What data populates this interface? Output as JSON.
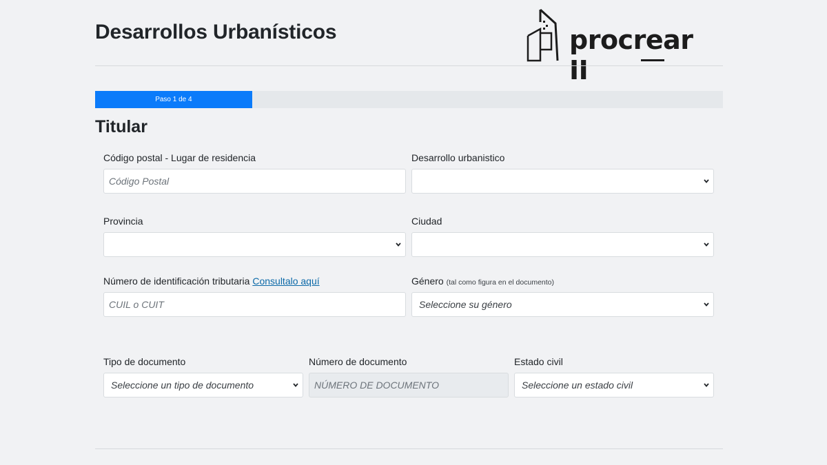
{
  "header": {
    "title": "Desarrollos Urbanísticos",
    "logo_text": "procrear II"
  },
  "progress": {
    "label": "Paso 1 de 4",
    "current_step": 1,
    "total_steps": 4,
    "fraction": 0.25,
    "fill_color": "#0b7bfa"
  },
  "section": {
    "title": "Titular"
  },
  "form": {
    "codigo_postal": {
      "label": "Código postal - Lugar de residencia",
      "placeholder": "Código Postal",
      "value": ""
    },
    "desarrollo": {
      "label": "Desarrollo urbanistico",
      "selected": ""
    },
    "provincia": {
      "label": "Provincia",
      "selected": ""
    },
    "ciudad": {
      "label": "Ciudad",
      "selected": ""
    },
    "cuil": {
      "label": "Número de identificación tributaria",
      "link": "Consultalo aquí",
      "placeholder": "CUIL o CUIT",
      "value": ""
    },
    "genero": {
      "label": "Género",
      "hint": "(tal como figura en el documento)",
      "selected": "Seleccione su género"
    },
    "tipo_documento": {
      "label": "Tipo de documento",
      "selected": "Seleccione un tipo de documento"
    },
    "numero_documento": {
      "label": "Número de documento",
      "placeholder": "NÚMERO DE DOCUMENTO"
    },
    "estado_civil": {
      "label": "Estado civil",
      "selected": "Seleccione un estado civil"
    }
  },
  "icons": {
    "select_arrow": "chevron-down-icon",
    "logo": "building-icon"
  }
}
